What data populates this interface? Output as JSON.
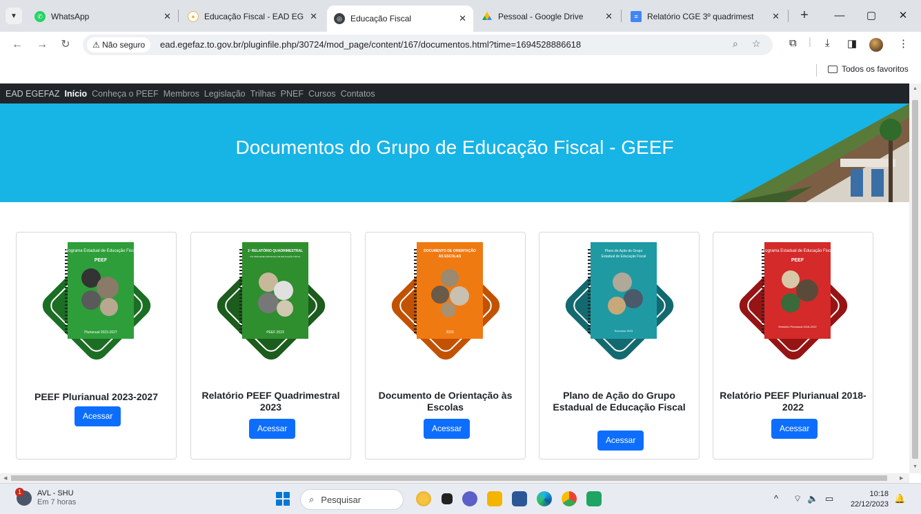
{
  "browser": {
    "tabs": [
      {
        "title": "WhatsApp",
        "favicon": "whatsapp-icon",
        "color": "#25d366",
        "active": false
      },
      {
        "title": "Educação Fiscal - EAD EGEFAZ",
        "favicon": "chat-bubble-icon",
        "color": "#e8b34a",
        "active": false
      },
      {
        "title": "Educação Fiscal",
        "favicon": "globe-icon",
        "color": "#3c4043",
        "active": true
      },
      {
        "title": "Pessoal - Google Drive",
        "favicon": "google-drive-icon",
        "color": "#fbbc04",
        "active": false
      },
      {
        "title": "Relatório CGE 3º quadrimest",
        "favicon": "google-docs-icon",
        "color": "#4285f4",
        "active": false
      }
    ],
    "security_label": "Não seguro",
    "url": "ead.egefaz.to.gov.br/pluginfile.php/30724/mod_page/content/167/documentos.html?time=1694528886618",
    "bookmarks_folder": "Todos os favoritos"
  },
  "site": {
    "nav": {
      "brand": "EAD EGEFAZ",
      "items": [
        "Início",
        "Conheça o PEEF",
        "Membros",
        "Legislação",
        "Trilhas",
        "PNEF",
        "Cursos",
        "Contatos"
      ],
      "active": "Início"
    },
    "banner_title": "Documentos do Grupo de Educação Fiscal - GEEF",
    "cards": [
      {
        "title": "PEEF Plurianual 2023-2027",
        "button": "Acessar",
        "cover_heading": "Programa Estadual de Educação Fiscal",
        "cover_brand": "PEEF",
        "cover_footer": "Plurianual 2023-2027",
        "color": "#2e9e3a",
        "dark": "#1b6e24"
      },
      {
        "title": "Relatório PEEF Quadrimestral 2023",
        "button": "Acessar",
        "cover_heading": "1º RELATÓRIO QUADRIMESTRAL",
        "cover_brand": "DO PROGRAMA ESTADUAL DE EDUCAÇÃO FISCAL",
        "cover_footer": "PEEF 2023",
        "color": "#2f8f2f",
        "dark": "#1c5c1c"
      },
      {
        "title": "Documento de Orientação às Escolas",
        "button": "Acessar",
        "cover_heading": "DOCUMENTO DE ORIENTAÇÃO",
        "cover_brand": "ÀS ESCOLAS",
        "cover_footer": "2023",
        "color": "#f07a12",
        "dark": "#c25200"
      },
      {
        "title": "Plano de Ação do Grupo Estadual de Educação Fiscal",
        "button": "Acessar",
        "cover_heading": "Plano de Ação do Grupo",
        "cover_brand": "Estadual de Educação Fiscal",
        "cover_footer": "Exercício 2023",
        "color": "#1f9aa3",
        "dark": "#126a70"
      },
      {
        "title": "Relatório PEEF Plurianual 2018-2022",
        "button": "Acessar",
        "cover_heading": "Programa Estadual de Educação Fiscal",
        "cover_brand": "PEEF",
        "cover_footer": "Relatório Plurianual 2018-2022",
        "color": "#d42a2a",
        "dark": "#961414"
      }
    ]
  },
  "taskbar": {
    "weather_badge": "1",
    "weather_title": "AVL - SHU",
    "weather_sub": "Em 7 horas",
    "search_placeholder": "Pesquisar",
    "time": "10:18",
    "date": "22/12/2023"
  }
}
